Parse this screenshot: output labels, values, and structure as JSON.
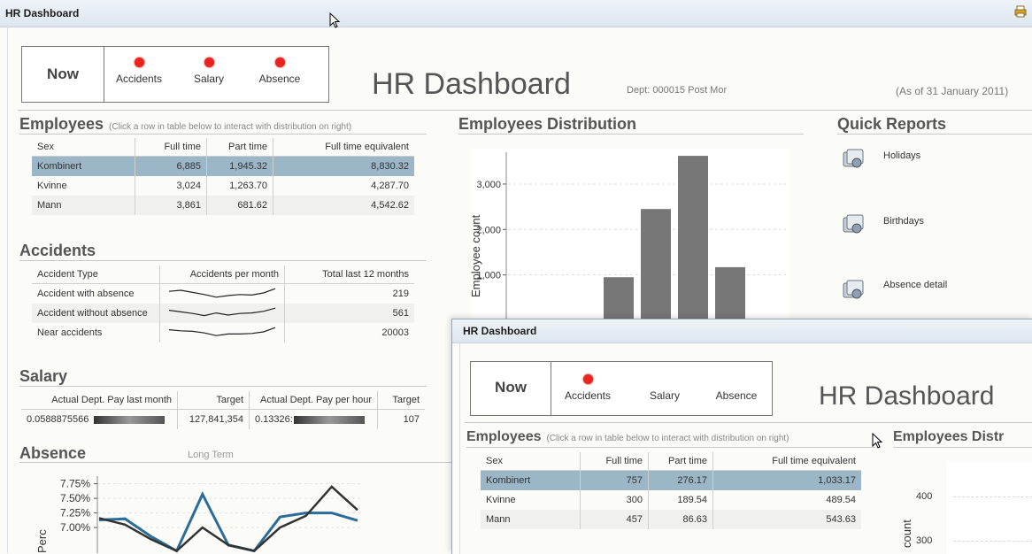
{
  "window": {
    "title": "HR Dashboard"
  },
  "header": {
    "now_label": "Now",
    "indicators": [
      {
        "label": "Accidents",
        "status": "red"
      },
      {
        "label": "Salary",
        "status": "red"
      },
      {
        "label": "Absence",
        "status": "red"
      }
    ],
    "title": "HR Dashboard",
    "dept": "Dept: 000015 Post Mor",
    "as_of": "(As of 31 January 2011)"
  },
  "employees": {
    "heading": "Employees",
    "hint": "(Click a row in table below to interact with distribution on right)",
    "columns": [
      "Sex",
      "Full time",
      "Part time",
      "Full time equivalent"
    ],
    "rows": [
      {
        "sex": "Kombinert",
        "full": "6,885",
        "part": "1,945.32",
        "fte": "8,830.32",
        "selected": true
      },
      {
        "sex": "Kvinne",
        "full": "3,024",
        "part": "1,263.70",
        "fte": "4,287.70"
      },
      {
        "sex": "Mann",
        "full": "3,861",
        "part": "681.62",
        "fte": "4,542.62"
      }
    ]
  },
  "accidents": {
    "heading": "Accidents",
    "columns": [
      "Accident Type",
      "Accidents per month",
      "Total last 12 months"
    ],
    "rows": [
      {
        "type": "Accident with absence",
        "total": "219",
        "spark": [
          0.35,
          0.25,
          0.45,
          0.65,
          0.9,
          0.75,
          0.65,
          0.7,
          0.5,
          0.1
        ]
      },
      {
        "type": "Accident without absence",
        "total": "561",
        "spark": [
          0.3,
          0.45,
          0.6,
          0.8,
          0.55,
          0.75,
          0.6,
          0.55,
          0.4,
          0.1
        ]
      },
      {
        "type": "Near accidents",
        "total": "20003",
        "spark": [
          0.3,
          0.4,
          0.45,
          0.6,
          0.85,
          0.7,
          0.7,
          0.65,
          0.5,
          0.1
        ]
      }
    ]
  },
  "salary": {
    "heading": "Salary",
    "columns": [
      "Actual Dept. Pay last month",
      "Target",
      "Actual Dept. Pay per hour",
      "Target"
    ],
    "row": {
      "pay_last_month": "0.0588875566",
      "target1": "127,841,354",
      "pay_per_hour": "0.13326:",
      "target2": "107"
    }
  },
  "absence": {
    "heading": "Absence",
    "subheading": "Long Term",
    "chart_data": {
      "type": "line",
      "ylabel": "Perc",
      "yticks": [
        "7.75%",
        "7.50%",
        "7.25%",
        "7.00%"
      ],
      "ylim": [
        6.9,
        7.85
      ],
      "series": [
        {
          "color": "#2a6c9a",
          "values": [
            7.13,
            7.15,
            6.85,
            6.6,
            7.57,
            6.7,
            6.6,
            7.18,
            7.25,
            7.25,
            7.12
          ]
        },
        {
          "color": "#333333",
          "values": [
            7.16,
            7.05,
            6.8,
            6.6,
            7.0,
            6.7,
            6.6,
            7.0,
            7.2,
            7.7,
            7.3
          ]
        }
      ]
    }
  },
  "distribution": {
    "heading": "Employees Distribution",
    "chart_data": {
      "type": "bar",
      "ylabel": "Employee count",
      "yticks": [
        "3,000",
        "2,000",
        "1,000"
      ],
      "ylim": [
        0,
        3700
      ],
      "values": [
        950,
        2450,
        3620,
        1170
      ]
    }
  },
  "quick_reports": {
    "heading": "Quick Reports",
    "items": [
      "Holidays",
      "Birthdays",
      "Absence detail"
    ]
  },
  "overlay": {
    "title": "HR Dashboard",
    "now_label": "Now",
    "indicators": [
      {
        "label": "Accidents",
        "status": "red"
      },
      {
        "label": "Salary",
        "status": "none"
      },
      {
        "label": "Absence",
        "status": "none"
      }
    ],
    "big_title": "HR Dashboard",
    "employees_heading": "Employees",
    "employees_hint": "(Click a row in table below to interact with distribution on right)",
    "columns": [
      "Sex",
      "Full time",
      "Part time",
      "Full time equivalent"
    ],
    "rows": [
      {
        "sex": "Kombinert",
        "full": "757",
        "part": "276.17",
        "fte": "1,033.17",
        "selected": true
      },
      {
        "sex": "Kvinne",
        "full": "300",
        "part": "189.54",
        "fte": "489.54"
      },
      {
        "sex": "Mann",
        "full": "457",
        "part": "86.63",
        "fte": "543.63"
      }
    ],
    "dist_heading": "Employees Distr",
    "dist_ylabel": "count",
    "dist_yticks": [
      "400",
      "300"
    ]
  }
}
